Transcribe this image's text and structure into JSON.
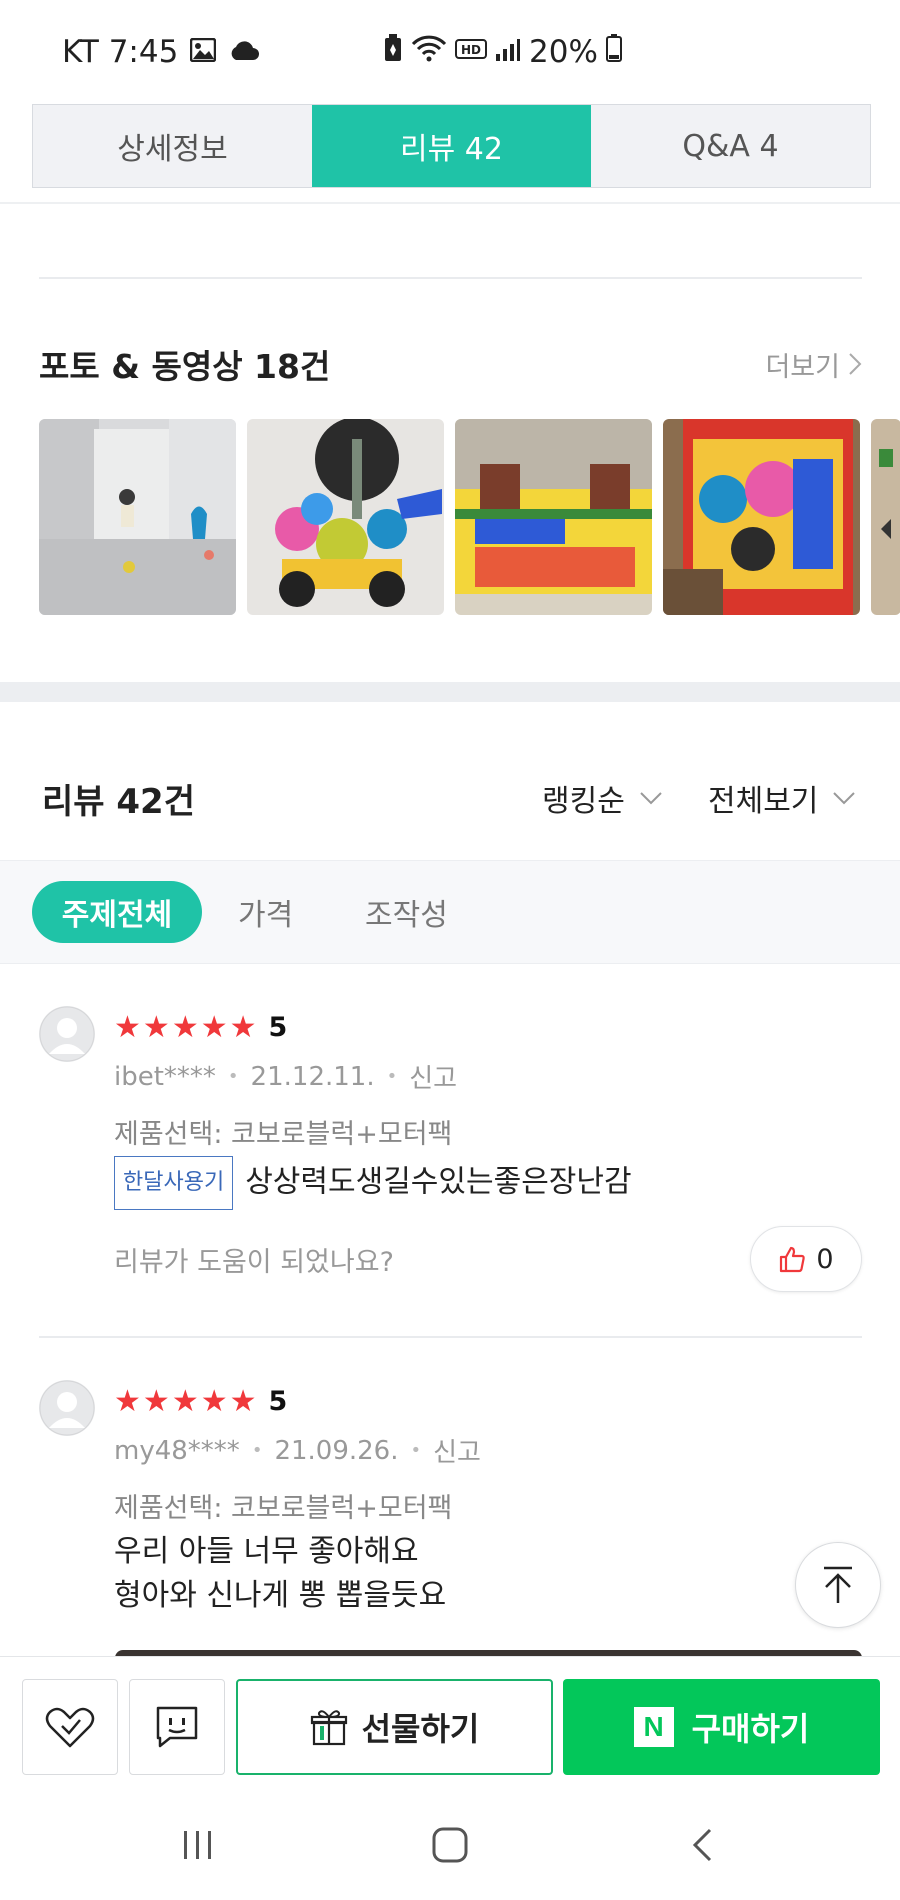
{
  "status_bar": {
    "carrier_time": "KT 7:45",
    "battery": "20%"
  },
  "tabs": [
    {
      "label": "상세정보",
      "active": false
    },
    {
      "label": "리뷰  42",
      "active": true
    },
    {
      "label": "Q&A  4",
      "active": false
    }
  ],
  "photo_section": {
    "title": "포토 & 동영상 18건",
    "more_label": "더보기"
  },
  "reviews_header": {
    "title": "리뷰 42건",
    "sort_label": "랭킹순",
    "filter_label": "전체보기"
  },
  "topics": [
    {
      "label": "주제전체",
      "active": true
    },
    {
      "label": "가격",
      "active": false
    },
    {
      "label": "조작성",
      "active": false
    }
  ],
  "reviews": [
    {
      "rating": "5",
      "stars": 5,
      "user": "ibet****",
      "date": "21.12.11.",
      "report": "신고",
      "option": "제품선택: 코보로블럭+모터팩",
      "badge": "한달사용기",
      "text": "상상력도생길수있는좋은장난감",
      "helpful_question": "리뷰가 도움이 되었나요?",
      "like_count": "0"
    },
    {
      "rating": "5",
      "stars": 5,
      "user": "my48****",
      "date": "21.09.26.",
      "report": "신고",
      "option": "제품선택: 코보로블럭+모터팩",
      "text_line1": "우리 아들 너무 좋아해요",
      "text_line2": "형아와 신나게 뽕 뽑을듯요"
    }
  ],
  "action_bar": {
    "gift_label": "선물하기",
    "buy_label": "구매하기",
    "naver_logo": "N"
  },
  "colors": {
    "accent_teal": "#1fc3a7",
    "naver_green": "#03c75a",
    "star_red": "#f0383b"
  }
}
